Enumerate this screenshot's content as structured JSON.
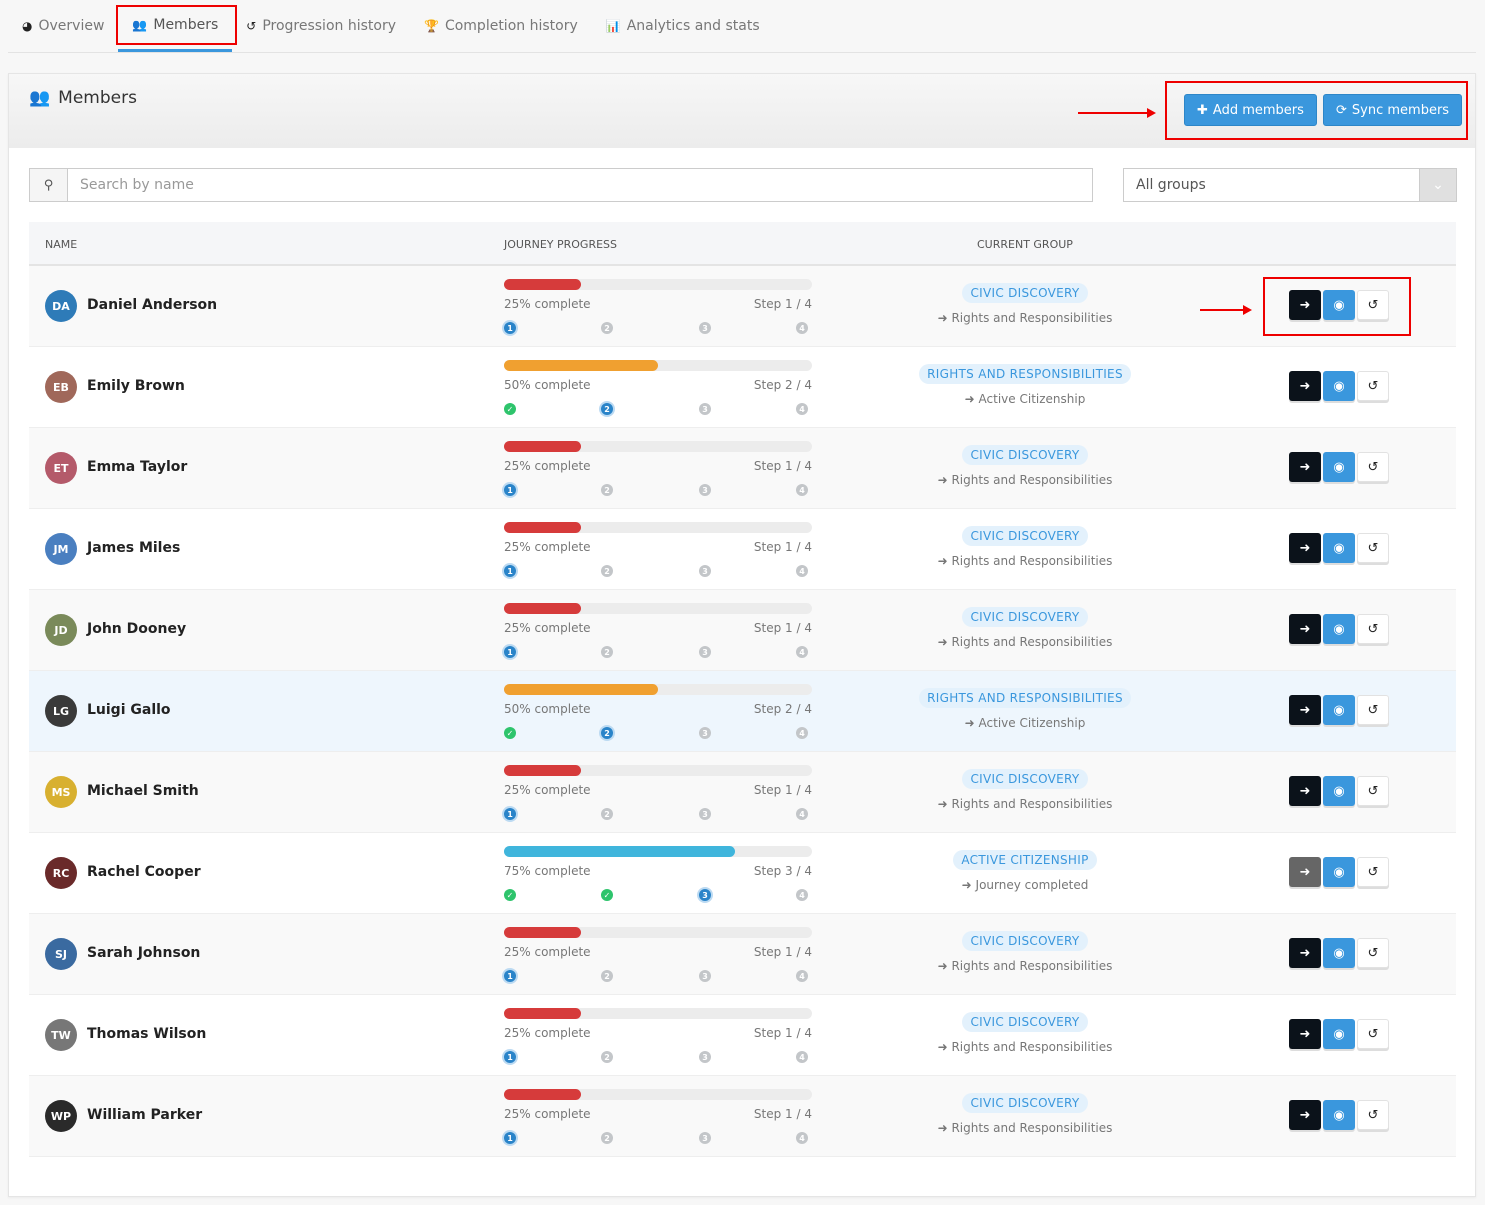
{
  "tabs": [
    {
      "label": "Overview",
      "icon": "dashboard-icon",
      "glyph": "◕"
    },
    {
      "label": "Members",
      "icon": "users-icon",
      "glyph": "👥"
    },
    {
      "label": "Progression history",
      "icon": "history-icon",
      "glyph": "↺"
    },
    {
      "label": "Completion history",
      "icon": "trophy-icon",
      "glyph": "🏆"
    },
    {
      "label": "Analytics and stats",
      "icon": "bar-chart-icon",
      "glyph": "📊"
    }
  ],
  "active_tab": 1,
  "panel": {
    "title": "Members",
    "add_label": "Add members",
    "sync_label": "Sync members"
  },
  "search": {
    "placeholder": "Search by name",
    "value": ""
  },
  "group_filter": {
    "selected": "All groups"
  },
  "columns": {
    "name": "Name",
    "progress": "Journey progress",
    "group": "Current group"
  },
  "colors": {
    "accent": "#3a97dd",
    "p25": "#d63b3b",
    "p50": "#f0a030",
    "p75": "#3fb5dc"
  },
  "members": [
    {
      "name": "Daniel Anderson",
      "percent": 25,
      "pct_label": "25% complete",
      "step": "Step 1 / 4",
      "current": 1,
      "group": "CIVIC DISCOVERY",
      "next": "Rights and Responsibilities",
      "avatar": "#2e7bb8"
    },
    {
      "name": "Emily Brown",
      "percent": 50,
      "pct_label": "50% complete",
      "step": "Step 2 / 4",
      "current": 2,
      "group": "RIGHTS AND RESPONSIBILITIES",
      "next": "Active Citizenship",
      "avatar": "#a0685a"
    },
    {
      "name": "Emma Taylor",
      "percent": 25,
      "pct_label": "25% complete",
      "step": "Step 1 / 4",
      "current": 1,
      "group": "CIVIC DISCOVERY",
      "next": "Rights and Responsibilities",
      "avatar": "#b45a6a"
    },
    {
      "name": "James Miles",
      "percent": 25,
      "pct_label": "25% complete",
      "step": "Step 1 / 4",
      "current": 1,
      "group": "CIVIC DISCOVERY",
      "next": "Rights and Responsibilities",
      "avatar": "#4a7fc0"
    },
    {
      "name": "John Dooney",
      "percent": 25,
      "pct_label": "25% complete",
      "step": "Step 1 / 4",
      "current": 1,
      "group": "CIVIC DISCOVERY",
      "next": "Rights and Responsibilities",
      "avatar": "#7a8a5a"
    },
    {
      "name": "Luigi Gallo",
      "percent": 50,
      "pct_label": "50% complete",
      "step": "Step 2 / 4",
      "current": 2,
      "group": "RIGHTS AND RESPONSIBILITIES",
      "next": "Active Citizenship",
      "avatar": "#3a3a3a"
    },
    {
      "name": "Michael Smith",
      "percent": 25,
      "pct_label": "25% complete",
      "step": "Step 1 / 4",
      "current": 1,
      "group": "CIVIC DISCOVERY",
      "next": "Rights and Responsibilities",
      "avatar": "#d8b030"
    },
    {
      "name": "Rachel Cooper",
      "percent": 75,
      "pct_label": "75% complete",
      "step": "Step 3 / 4",
      "current": 3,
      "group": "ACTIVE CITIZENSHIP",
      "next": "Journey completed",
      "avatar": "#6a2a2a"
    },
    {
      "name": "Sarah Johnson",
      "percent": 25,
      "pct_label": "25% complete",
      "step": "Step 1 / 4",
      "current": 1,
      "group": "CIVIC DISCOVERY",
      "next": "Rights and Responsibilities",
      "avatar": "#3a6aa0"
    },
    {
      "name": "Thomas Wilson",
      "percent": 25,
      "pct_label": "25% complete",
      "step": "Step 1 / 4",
      "current": 1,
      "group": "CIVIC DISCOVERY",
      "next": "Rights and Responsibilities",
      "avatar": "#777777"
    },
    {
      "name": "William Parker",
      "percent": 25,
      "pct_label": "25% complete",
      "step": "Step 1 / 4",
      "current": 1,
      "group": "CIVIC DISCOVERY",
      "next": "Rights and Responsibilities",
      "avatar": "#2a2a2a"
    }
  ]
}
